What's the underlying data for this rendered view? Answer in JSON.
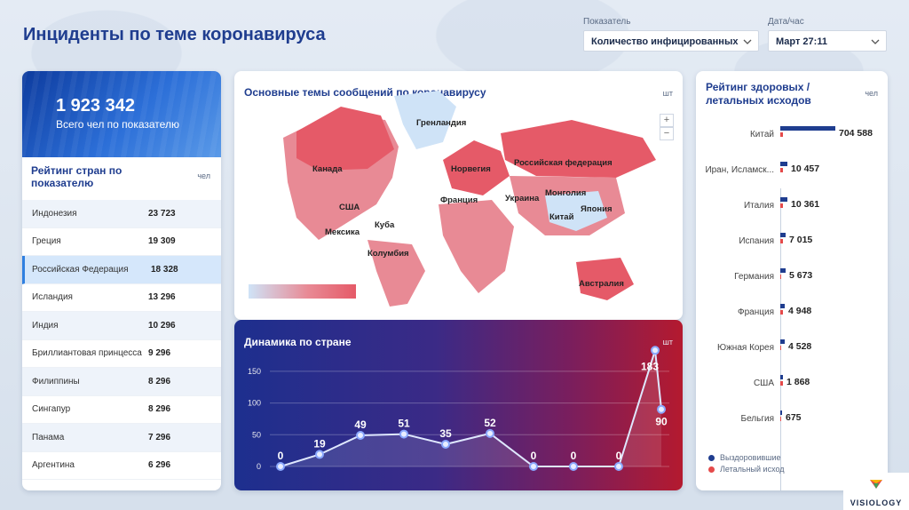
{
  "header": {
    "title": "Инциденты по теме коронавируса",
    "metric_label": "Показатель",
    "metric_value": "Количество инфицированных",
    "date_label": "Дата/час",
    "date_value": "Март  27:11"
  },
  "left": {
    "total": "1 923 342",
    "total_caption": "Всего чел по показателю",
    "rank_title": "Рейтинг стран по показателю",
    "rank_unit": "чел",
    "rows": [
      {
        "name": "Индонезия",
        "value": "23 723"
      },
      {
        "name": "Греция",
        "value": "19 309"
      },
      {
        "name": "Российская Федерация",
        "value": "18 328",
        "selected": true
      },
      {
        "name": "Исландия",
        "value": "13 296"
      },
      {
        "name": "Индия",
        "value": "10 296"
      },
      {
        "name": "Бриллиантовая принцесса",
        "value": "9 296"
      },
      {
        "name": "Филиппины",
        "value": "8 296"
      },
      {
        "name": "Сингапур",
        "value": "8 296"
      },
      {
        "name": "Панама",
        "value": "7 296"
      },
      {
        "name": "Аргентина",
        "value": "6 296"
      }
    ]
  },
  "map": {
    "title": "Основные темы сообщений по коронавирусу",
    "unit": "шт",
    "zoom_in": "+",
    "zoom_out": "−",
    "labels": [
      "Гренландия",
      "Канада",
      "США",
      "Мексика",
      "Куба",
      "Колумбия",
      "Норвегия",
      "Франция",
      "Украина",
      "Российская федерация",
      "Монголия",
      "Китай",
      "Япония",
      "Австралия"
    ]
  },
  "dynamics": {
    "title": "Динамика по стране",
    "unit": "шт"
  },
  "ratings": {
    "title": "Рейтинг здоровых / летальных исходов",
    "unit": "чел",
    "legend_recovered": "Выздоровившие",
    "legend_death": "Летальный исход",
    "colors": {
      "recovered": "#1f3d8f",
      "death": "#e54a4a"
    }
  },
  "brand": {
    "name": "VISIOLOGY"
  },
  "chart_data": [
    {
      "type": "line",
      "title": "Динамика по стране",
      "ylabel": "шт",
      "ylim": [
        0,
        175
      ],
      "yticks": [
        0,
        50,
        100,
        150
      ],
      "grid": true,
      "values": [
        0,
        19,
        49,
        51,
        35,
        52,
        0,
        0,
        0,
        183,
        90
      ]
    },
    {
      "type": "bar",
      "title": "Рейтинг здоровых / летальных исходов",
      "categories": [
        "Китай",
        "Иран, Исламск...",
        "Италия",
        "Испания",
        "Германия",
        "Франция",
        "Южная Корея",
        "США",
        "Бельгия"
      ],
      "series": [
        {
          "name": "Выздоровившие",
          "values": [
            704588,
            10457,
            10361,
            7015,
            5673,
            4948,
            4528,
            1868,
            675
          ]
        },
        {
          "name": "Летальный исход",
          "values": [
            3,
            3,
            3,
            1,
            0,
            2,
            0,
            1,
            0
          ]
        }
      ],
      "value_labels": [
        "704 588",
        "10 457",
        "10 361",
        "7 015",
        "5 673",
        "4 948",
        "4 528",
        "1 868",
        "675"
      ]
    }
  ]
}
